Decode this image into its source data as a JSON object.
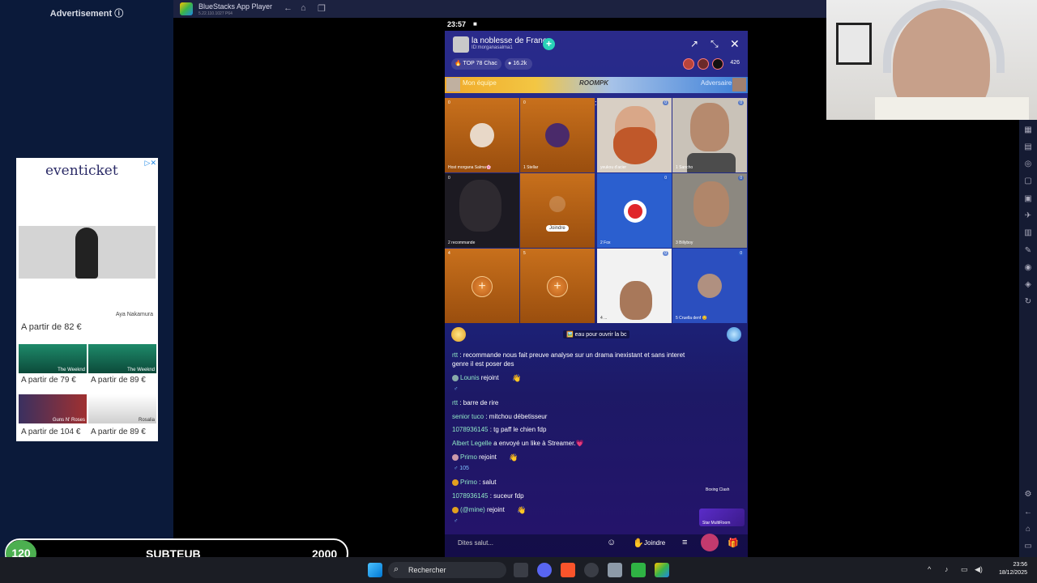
{
  "ad": {
    "header": "Advertisement ⓘ",
    "brand": "eventicket",
    "close": "▷✕",
    "hero_caption": "Aya Nakamura",
    "main_price": "A partir de 82 €",
    "tiles": [
      {
        "caption": "The Weeknd",
        "price": "A partir de 79 €"
      },
      {
        "caption": "The Weeknd",
        "price": "A partir de 89 €"
      },
      {
        "caption": "Guns N' Roses",
        "price": "A partir de 104 €"
      },
      {
        "caption": "Rosalia",
        "price": "A partir de 89 €"
      }
    ]
  },
  "bluestacks": {
    "title": "BlueStacks App Player",
    "subtitle": "5.22.110.1027 P64"
  },
  "phone": {
    "status_time": "23:57",
    "room_name": "la noblesse de France",
    "room_id": "ID:morganasalma1",
    "rank_badge": "TOP 78 Chac",
    "coins": "16.2k",
    "viewer_count": "426",
    "pk_left": "Mon équipe",
    "pk_mid": "ROOMPK",
    "pk_right": "Adversaire",
    "timer": "03:38",
    "tiles": [
      {
        "name": "Host  morgana Salma🌸",
        "top": "0"
      },
      {
        "name": "1  Stellar",
        "top": "0"
      },
      {
        "name": "yeukou d'acier",
        "topr": "0"
      },
      {
        "name": "1  Sancho",
        "topr": "0"
      },
      {
        "name": "2  recommande",
        "top": "0"
      },
      {
        "join": "Joindre"
      },
      {
        "name": "2  Fox",
        "topr": "0"
      },
      {
        "name": "3  Billyboy",
        "topr": "0"
      },
      {
        "top": "4"
      },
      {
        "top": "5"
      },
      {
        "name": "4  ...",
        "topr": "0"
      },
      {
        "name": "5  Cruella denf 😊",
        "topr": "0"
      }
    ],
    "banner": "🖼️ eau pour ouvrir la bc",
    "chat": [
      {
        "user": "rtt",
        "text": " : recommande nous fait preuve analyse sur un drama inexistant et sans interet genre il est poser des"
      },
      {
        "user": "Lounis",
        "text": " rejoint"
      },
      {
        "user": "rtt",
        "text": " : barre de rire"
      },
      {
        "user": "senior tuco",
        "text": " : mitchou débetisseur"
      },
      {
        "user": "1078936145",
        "text": " : tg paff le chien fdp"
      },
      {
        "user": "Albert Legelle",
        "text": " a envoyé un like à Streamer.💗"
      },
      {
        "user": "Primo",
        "text": " rejoint"
      },
      {
        "user": "Primo",
        "text": " : salut"
      },
      {
        "user": "1078936145",
        "text": " : suceur fdp"
      },
      {
        "user": "(@mine)",
        "text": " rejoint"
      }
    ],
    "primo_level": "105",
    "boxing": "Boxing Clash",
    "star": "Star MultiRoom",
    "say_hi": "Dites salut...",
    "join": "Joindre"
  },
  "taskbar": {
    "search": "Rechercher",
    "time": "23:56",
    "date": "18/12/2025"
  },
  "goal": {
    "count": "120",
    "label": "SUBTEUB",
    "target": "2000"
  }
}
